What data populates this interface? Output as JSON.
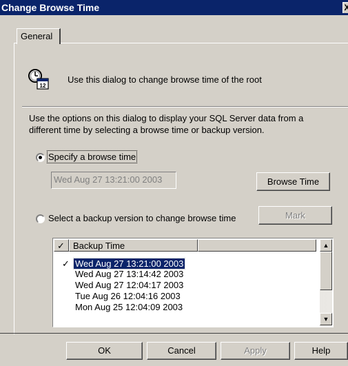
{
  "window": {
    "title": "Change Browse Time",
    "close_glyph": "X"
  },
  "tabs": [
    {
      "label": "General"
    }
  ],
  "info": {
    "icon": "clock-calendar-icon",
    "text": "Use this dialog to change browse time of the root"
  },
  "description": "Use the options on this dialog to display your SQL Server data from a different time by selecting a browse time or backup version.",
  "options": {
    "specify": {
      "label": "Specify a browse time",
      "selected": true
    },
    "browse_time_value": "Wed Aug 27 13:21:00 2003",
    "browse_time_button": "Browse Time",
    "backup": {
      "label": "Select a backup version to change browse time",
      "selected": false
    },
    "mark_button": "Mark"
  },
  "backup_list": {
    "columns": [
      "✓",
      "Backup Time"
    ],
    "rows": [
      {
        "checked": true,
        "selected": true,
        "time": "Wed Aug 27 13:21:00 2003"
      },
      {
        "checked": false,
        "selected": false,
        "time": "Wed Aug 27 13:14:42 2003"
      },
      {
        "checked": false,
        "selected": false,
        "time": "Wed Aug 27 12:04:17 2003"
      },
      {
        "checked": false,
        "selected": false,
        "time": "Tue Aug 26 12:04:16 2003"
      },
      {
        "checked": false,
        "selected": false,
        "time": "Mon Aug 25 12:04:09 2003"
      }
    ]
  },
  "footer": {
    "ok": "OK",
    "cancel": "Cancel",
    "apply": "Apply",
    "help": "Help"
  }
}
